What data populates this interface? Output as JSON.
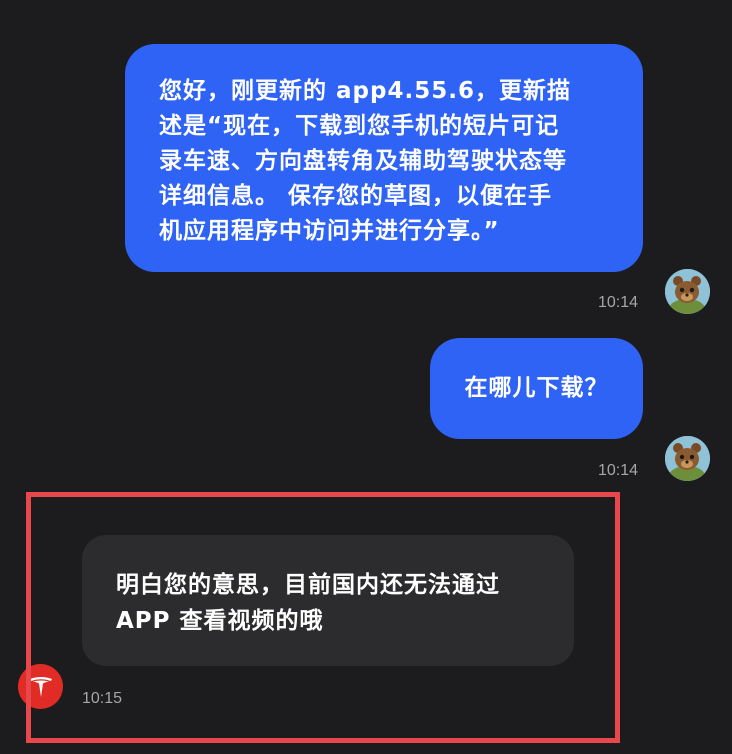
{
  "messages": [
    {
      "direction": "outgoing",
      "lines": [
        "您好，刚更新的 app4.55.6，更新描",
        "述是“现在，下载到您手机的短片可记",
        "录车速、方向盘转角及辅助驾驶状态等",
        "详细信息。 保存您的草图，以便在手",
        "机应用程序中访问并进行分享。”"
      ],
      "time": "10:14",
      "avatar_icon": "bear-cartoon-avatar"
    },
    {
      "direction": "outgoing",
      "text": "在哪儿下载？",
      "time": "10:14",
      "avatar_icon": "bear-cartoon-avatar"
    },
    {
      "direction": "incoming",
      "lines": [
        "明白您的意思，目前国内还无法通过",
        "APP 查看视频的哦"
      ],
      "time": "10:15",
      "avatar_icon": "tesla-logo-icon"
    }
  ],
  "colors": {
    "background": "#1c1c1e",
    "outgoing_bubble": "#2f63f5",
    "incoming_bubble": "#2c2c2e",
    "highlight": "#e8474b",
    "tesla_red": "#e12b25",
    "timestamp": "#a6a6aa"
  }
}
